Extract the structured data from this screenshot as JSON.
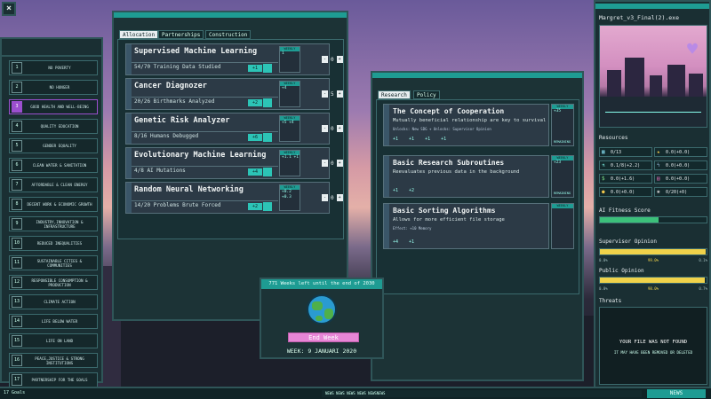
{
  "app": {
    "close_label": "×"
  },
  "goals": {
    "items": [
      {
        "n": "1",
        "label": "NO POVERTY"
      },
      {
        "n": "2",
        "label": "NO HUNGER"
      },
      {
        "n": "3",
        "label": "GOOD HEALTH AND WELL-BEING"
      },
      {
        "n": "4",
        "label": "QUALITY EDUCATION"
      },
      {
        "n": "5",
        "label": "GENDER EQUALITY"
      },
      {
        "n": "6",
        "label": "CLEAN WATER & SANITATION"
      },
      {
        "n": "7",
        "label": "AFFORDABLE & CLEAN ENERGY"
      },
      {
        "n": "8",
        "label": "DECENT WORK & ECONOMIC GROWTH"
      },
      {
        "n": "9",
        "label": "INDUSTRY,INNOVATION & INFRASTRUCTURE"
      },
      {
        "n": "10",
        "label": "REDUCED INEQUALITIES"
      },
      {
        "n": "11",
        "label": "SUSTAINABLE CITIES & COMMUNITIES"
      },
      {
        "n": "12",
        "label": "RESPONSIBLE CONSUMPTION & PRODUCTION"
      },
      {
        "n": "13",
        "label": "CLIMATE ACTION"
      },
      {
        "n": "14",
        "label": "LIFE BELOW WATER"
      },
      {
        "n": "15",
        "label": "LIFE ON LAND"
      },
      {
        "n": "16",
        "label": "PEACE,JUSTICE & STRONG INSTITUTIONS"
      },
      {
        "n": "17",
        "label": "PARTNERSHIP FOR THE GOALS"
      }
    ],
    "count_label": "17 Goals"
  },
  "allocation": {
    "tabs": [
      "Allocation",
      "Partnerships",
      "Construction"
    ],
    "weekly_label": "WEEKLY",
    "projects": [
      {
        "title": "Supervised Machine Learning",
        "progress": "54/70 Training Data Studied",
        "chip": "+1",
        "weekly": "1",
        "count": "0"
      },
      {
        "title": "Cancer Diagnozer",
        "progress": "20/26 Birthmarks Analyzed",
        "chip": "+2",
        "weekly": "+4",
        "count": "5"
      },
      {
        "title": "Genetic Risk Analyzer",
        "progress": "8/16 Humans Debugged",
        "chip": "+6",
        "weekly": "+5 +4",
        "count": "0"
      },
      {
        "title": "Evolutionary Machine Learning",
        "progress": "4/8 AI Mutations",
        "chip": "+4",
        "weekly": "+1.1 +1",
        "count": "0"
      },
      {
        "title": "Random Neural Networking",
        "progress": "14/20 Problems Brute Forced",
        "chip": "+2",
        "weekly": "+0.2 +0.3",
        "count": "0"
      }
    ],
    "minus": "-",
    "plus": "+"
  },
  "research": {
    "tabs": [
      "Research",
      "Policy"
    ],
    "weekly_label": "WEEKLY",
    "items": [
      {
        "title": "The Concept of Cooperation",
        "desc": "Mutually beneficial relationship are key to survival",
        "extra": "Unlocks: New SDG + Unlocks: Supervisor Opinion",
        "costs": [
          "+1",
          "+1",
          "+1",
          "+1"
        ],
        "weekly": "+35",
        "remaining": "REMAINING"
      },
      {
        "title": "Basic Research Subroutines",
        "desc": "Reevaluates previous data in the background",
        "extra": "",
        "costs": [
          "+1",
          "+2"
        ],
        "weekly": "+23",
        "remaining": "REMAINING"
      },
      {
        "title": "Basic Sorting Algorithms",
        "desc": "Allows for more efficient file storage",
        "extra": "Effect: +10 Memory",
        "costs": [
          "+4",
          "+1"
        ],
        "weekly": "",
        "remaining": ""
      }
    ]
  },
  "endweek": {
    "header": "771 Weeks left until the end of 2030",
    "button": "End Week",
    "date": "WEEK: 9 JANUARI 2020"
  },
  "right": {
    "window_title": "Margret_v3_Final(2).exe",
    "resources_title": "Resources",
    "resources": [
      {
        "icon": "memory-icon",
        "value": "0/13"
      },
      {
        "icon": "star-icon",
        "value": "0.0(+0.0)"
      },
      {
        "icon": "flask-icon",
        "value": "0.1/8(+2.2)"
      },
      {
        "icon": "bolt-icon",
        "value": "0.0(+0.0)"
      },
      {
        "icon": "money-icon",
        "value": "0.0(+1.6)"
      },
      {
        "icon": "data-icon",
        "value": "0.0(+0.0)"
      },
      {
        "icon": "coin-icon",
        "value": "0.0(+0.0)"
      },
      {
        "icon": "gear-icon",
        "value": "0/20(+0)"
      }
    ],
    "fitness_title": "AI Fitness Score",
    "fitness_level": 0.55,
    "supervisor_title": "Supervisor Opinion",
    "supervisor_ticks": [
      "0.0%",
      "99.0%",
      "0.1%"
    ],
    "supervisor_level": 0.99,
    "public_title": "Public Opinion",
    "public_ticks": [
      "0.0%",
      "98.0%",
      "0.7%"
    ],
    "public_level": 0.98,
    "threats_title": "Threats",
    "threat_main": "YOUR FILE WAS NOT FOUND",
    "threat_sub": "IT MAY HAVE BEEN REMOVED OR DELETED"
  },
  "bottom": {
    "ticker": "NEWS NEWS NEWS NEWS NEWSNEWS",
    "news_button": "NEWS"
  },
  "colors": {
    "accent": "#1e9c93",
    "button_pink": "#e786d6",
    "meter_yellow": "#f0d24a",
    "meter_green": "#3cc07a"
  }
}
